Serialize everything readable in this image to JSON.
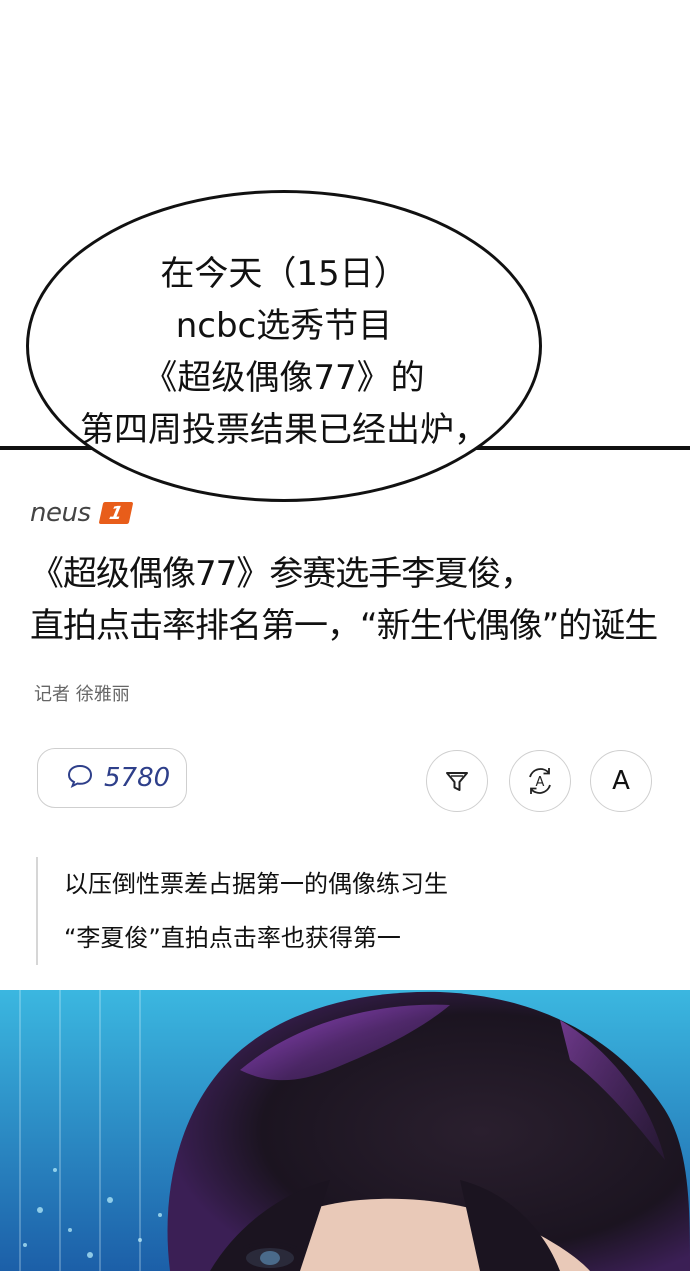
{
  "bubble": {
    "lines": [
      "在今天（15日）",
      "ncbc选秀节目",
      "《超级偶像77》的",
      "第四周投票结果已经出炉，"
    ]
  },
  "article": {
    "brand": "neus",
    "brand_badge": "1",
    "headline_lines": [
      "《超级偶像77》参赛选手李夏俊，",
      "直拍点击率排名第一，“新生代偶像”的诞生"
    ],
    "byline": "记者 徐雅丽",
    "comment_count": "5780",
    "font_button_label": "A",
    "quote_lines": [
      "以压倒性票差占据第一的偶像练习生",
      "“李夏俊”直拍点击率也获得第一"
    ]
  },
  "icons": {
    "comment": "speech-bubble-icon",
    "filter": "funnel-icon",
    "translate": "translate-icon",
    "font_size": "font-size-icon"
  },
  "colors": {
    "brand_badge": "#e85d1a",
    "comment_count": "#2e3f8a"
  }
}
